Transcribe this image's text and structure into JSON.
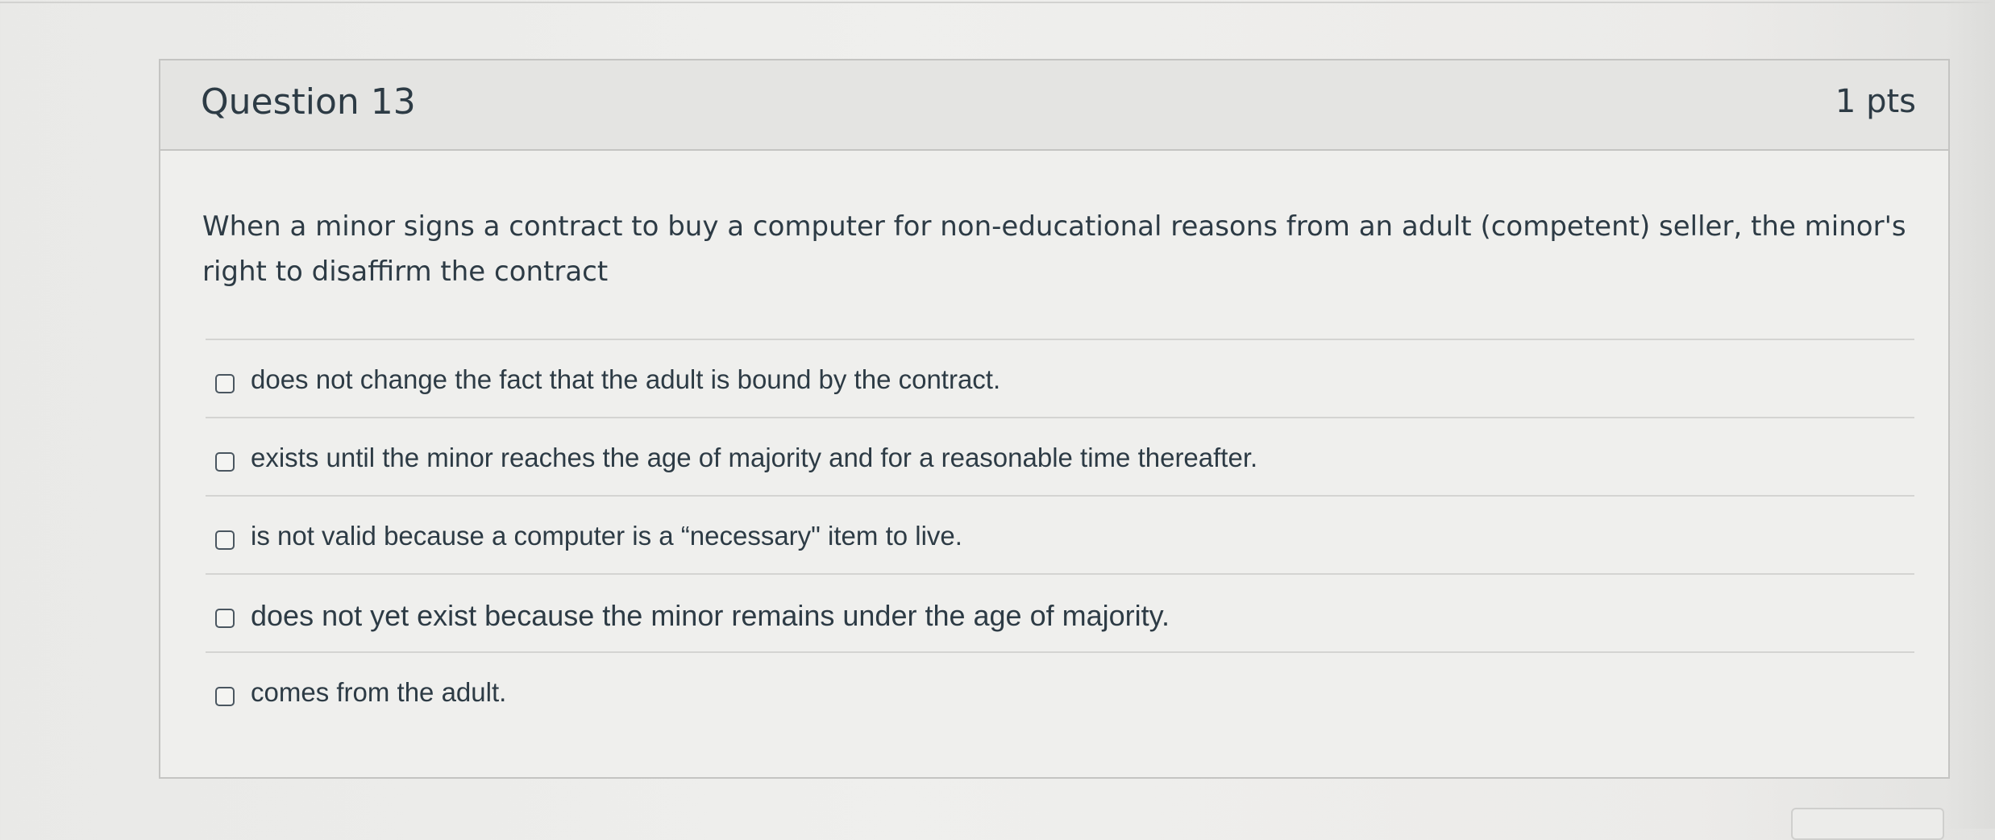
{
  "question": {
    "title": "Question 13",
    "points": "1 pts",
    "text": "When a minor signs a contract to buy a computer for non-educational reasons from an adult (competent) seller, the minor's right to disaffirm the contract"
  },
  "answers": [
    {
      "label": "does not change the fact that the adult is bound by the contract.",
      "checked": false
    },
    {
      "label": "exists until the minor reaches the age of majority and for a reasonable time thereafter.",
      "checked": false
    },
    {
      "label": "is not valid because a computer is a “necessary\" item to live.",
      "checked": false
    },
    {
      "label": "does not yet exist because the minor remains under the age of majority.",
      "checked": false
    },
    {
      "label": "comes from the adult.",
      "checked": false
    }
  ],
  "colors": {
    "text": "#2d3b45",
    "header_bg": "#e4e4e2",
    "border": "#c4c4c2",
    "page_bg": "#ececea"
  }
}
